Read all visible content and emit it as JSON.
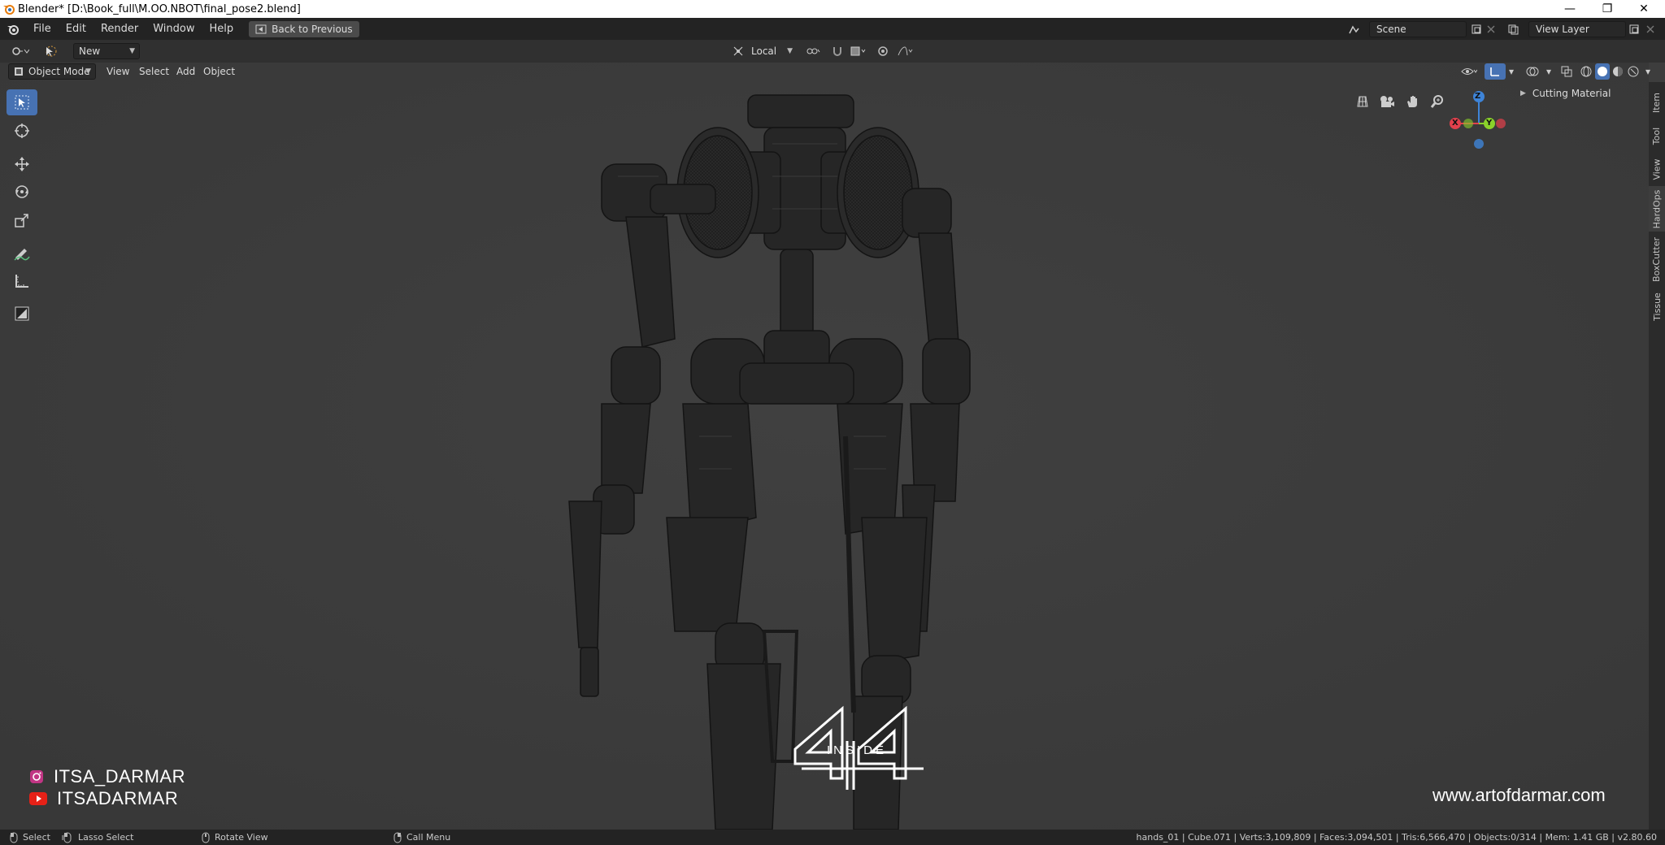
{
  "window": {
    "title": "Blender* [D:\\Book_full\\M.OO.NBOT\\final_pose2.blend]",
    "minimize": "—",
    "restore": "❐",
    "close": "✕"
  },
  "menubar": {
    "items": [
      "File",
      "Edit",
      "Render",
      "Window",
      "Help"
    ],
    "back_button": "Back to Previous",
    "scene": "Scene",
    "view_layer": "View Layer"
  },
  "header": {
    "editor_new": "New",
    "transform_orientation": "Local"
  },
  "viewport_header": {
    "mode": "Object Mode",
    "menus": [
      "View",
      "Select",
      "Add",
      "Object"
    ]
  },
  "sidebar": {
    "tabs": [
      "Item",
      "Tool",
      "View",
      "HardOps",
      "BoxCutter",
      "Tissue"
    ],
    "active_tab": "HardOps",
    "panel_title": "Cutting Material"
  },
  "gizmo": {
    "axes": [
      "Z",
      "Y",
      "X"
    ],
    "colors": {
      "x": "#e2404c",
      "y": "#8ad12a",
      "z": "#3e84d8"
    }
  },
  "overlay": {
    "instagram_handle": "ITSA_DARMAR",
    "youtube_handle": "ITSADARMAR",
    "logo_label": "INSIDE",
    "logo_number": "44",
    "website": "www.artofdarmar.com"
  },
  "statusbar": {
    "select": "Select",
    "lasso": "Lasso Select",
    "rotate": "Rotate View",
    "call_menu": "Call Menu",
    "stats": "hands_01 | Cube.071 | Verts:3,109,809 | Faces:3,094,501 | Tris:6,566,470 | Objects:0/314 | Mem: 1.41 GB | v2.80.60"
  },
  "colors": {
    "accent": "#4772b3",
    "viewport_bg": "#3d3d3d"
  }
}
